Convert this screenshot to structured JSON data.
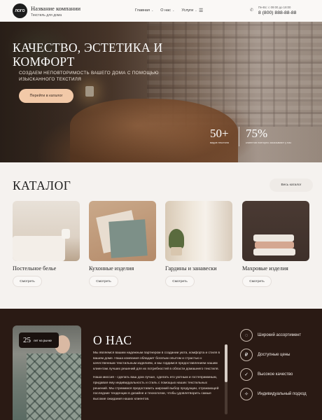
{
  "header": {
    "logo": "ЛОГО",
    "company_name": "Название компании",
    "company_sub": "Текстиль для дома",
    "nav": [
      {
        "label": "Главная",
        "chevron": "⌄"
      },
      {
        "label": "О нас",
        "chevron": "⌄"
      },
      {
        "label": "Услуги",
        "chevron": "⌄"
      }
    ],
    "menu_icon": "☰",
    "hours": "Пн-Вс: с 09:00 до 18:00",
    "phone": "8 (800) 888-88-88"
  },
  "hero": {
    "title": "КАЧЕСТВО, ЭСТЕТИКА И КОМФОРТ",
    "subtitle": "СОЗДАЕМ НЕПОВТОРИМОСТЬ ВАШЕГО ДОМА С ПОМОЩЬЮ ИЗЫСКАННОГО ТЕКСТИЛЯ",
    "button": "Перейти в каталог",
    "stats": [
      {
        "value": "50+",
        "label": "видов текстиля"
      },
      {
        "value": "75%",
        "label": "клиентов повторно заказывают у нас"
      }
    ]
  },
  "catalog": {
    "title": "КАТАЛОГ",
    "all_button": "Весь каталог",
    "items": [
      {
        "name": "Постельное белье",
        "button": "Смотреть"
      },
      {
        "name": "Кухонные изделия",
        "button": "Смотреть"
      },
      {
        "name": "Гардины и занавески",
        "button": "Смотреть"
      },
      {
        "name": "Махровые изделия",
        "button": "Смотреть"
      }
    ]
  },
  "about": {
    "years_value": "25",
    "years_label": "лет на рынке",
    "title": "О НАС",
    "paragraphs": [
      "Мы являемся вашим надежным партнером в создании уюта, комфорта и стиля в вашем доме. Наша компания обладает богатым опытом и страстью к качественным текстильным изделиям, и мы гордимся предоставлением нашим клиентам лучших решений для их потребностей в области домашнего текстиля.",
      "Наша миссия - сделать ваш дом лучше, сделать его уютным и гостеприимным, придавая ему индивидуальность и стиль с помощью наших текстильных решений. Мы стремимся предоставить широкий выбор продукции, отражающей последние тенденции в дизайне и технологии, чтобы удовлетворить самые высокие ожидания наших клиентов."
    ],
    "features": [
      {
        "icon": "◌",
        "label": "Широкий ассортимент"
      },
      {
        "icon": "₽",
        "label": "Доступные цены"
      },
      {
        "icon": "✓",
        "label": "Высокое качество"
      },
      {
        "icon": "✧",
        "label": "Индивидуальный подход"
      }
    ]
  }
}
